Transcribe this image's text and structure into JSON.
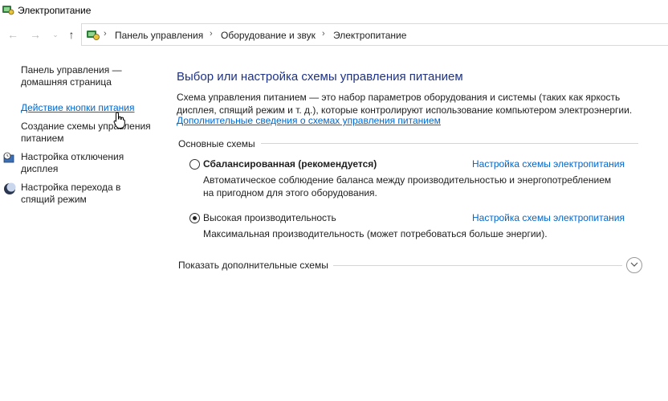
{
  "window": {
    "title": "Электропитание",
    "app_icon": "power-options-icon"
  },
  "navigation": {
    "back_icon": "back-arrow-icon",
    "forward_icon": "forward-arrow-icon",
    "recent_icon": "chevron-down-icon",
    "up_icon": "up-arrow-icon"
  },
  "breadcrumb": {
    "items": [
      "Панель управления",
      "Оборудование и звук",
      "Электропитание"
    ],
    "separator": "›"
  },
  "sidebar": {
    "items": [
      {
        "label_lines": [
          "Панель управления —",
          "домашняя страница"
        ]
      },
      {
        "label_lines": [
          "Действие кнопки питания"
        ]
      },
      {
        "label_lines": [
          "Создание схемы управления",
          "питанием"
        ]
      },
      {
        "label_lines": [
          "Настройка отключения",
          "дисплея"
        ],
        "icon": "display-clock-icon"
      },
      {
        "label_lines": [
          "Настройка перехода в",
          "спящий режим"
        ],
        "icon": "moon-icon"
      }
    ]
  },
  "main": {
    "title": "Выбор или настройка схемы управления питанием",
    "description_lines": [
      "Схема управления питанием — это набор параметров оборудования и системы (таких как яркость",
      "дисплея, спящий режим и т. д.), которые контролируют использование компьютером электроэнергии."
    ],
    "more_info_link": "Дополнительные сведения о схемах управления питанием",
    "group_label": "Основные схемы",
    "plans": [
      {
        "name": "Сбалансированная (рекомендуется)",
        "selected": false,
        "description_lines": [
          "Автоматическое соблюдение баланса между производительностью и энергопотреблением",
          "на пригодном для этого оборудования."
        ],
        "settings_link": "Настройка схемы электропитания"
      },
      {
        "name": "Высокая производительность",
        "selected": true,
        "description_lines": [
          "Максимальная производительность (может потребоваться больше энергии)."
        ],
        "settings_link": "Настройка схемы электропитания"
      }
    ],
    "show_more": "Показать дополнительные схемы"
  },
  "colors": {
    "title_blue": "#1e3287",
    "link_blue": "#0066cc"
  }
}
